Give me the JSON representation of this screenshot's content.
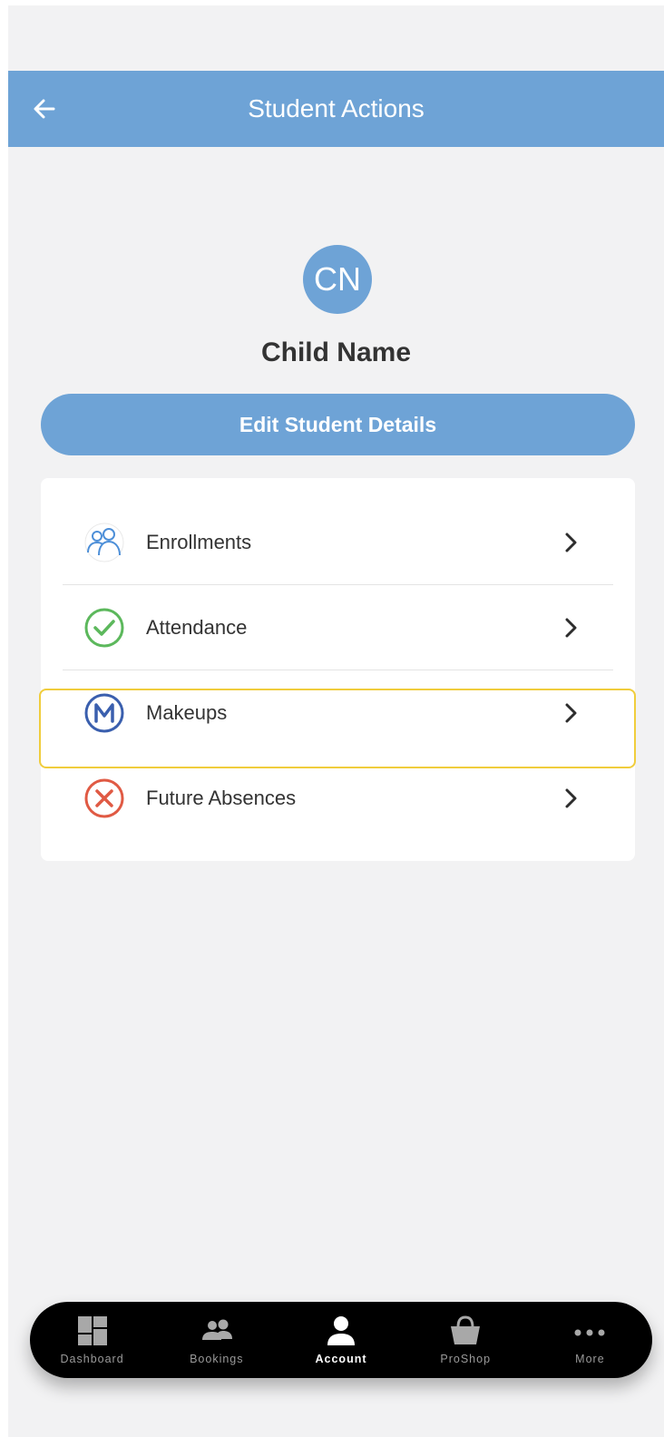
{
  "header": {
    "title": "Student Actions"
  },
  "student": {
    "initials": "CN",
    "name": "Child Name"
  },
  "edit_button": {
    "label": "Edit Student Details"
  },
  "actions": [
    {
      "label": "Enrollments",
      "icon": "people-icon"
    },
    {
      "label": "Attendance",
      "icon": "check-circle-icon"
    },
    {
      "label": "Makeups",
      "icon": "makeup-m-icon"
    },
    {
      "label": "Future Absences",
      "icon": "x-circle-icon"
    }
  ],
  "nav": [
    {
      "label": "Dashboard",
      "icon": "dashboard-icon"
    },
    {
      "label": "Bookings",
      "icon": "people-icon"
    },
    {
      "label": "Account",
      "icon": "person-icon",
      "active": true
    },
    {
      "label": "ProShop",
      "icon": "shopping-basket-icon"
    },
    {
      "label": "More",
      "icon": "more-dots-icon"
    }
  ],
  "colors": {
    "primary": "#6ea3d6",
    "background": "#f2f2f3",
    "check_green": "#5cb85c",
    "makeup_blue": "#3a5fae",
    "absence_red": "#e05a44",
    "highlight": "#f0cd3c"
  }
}
